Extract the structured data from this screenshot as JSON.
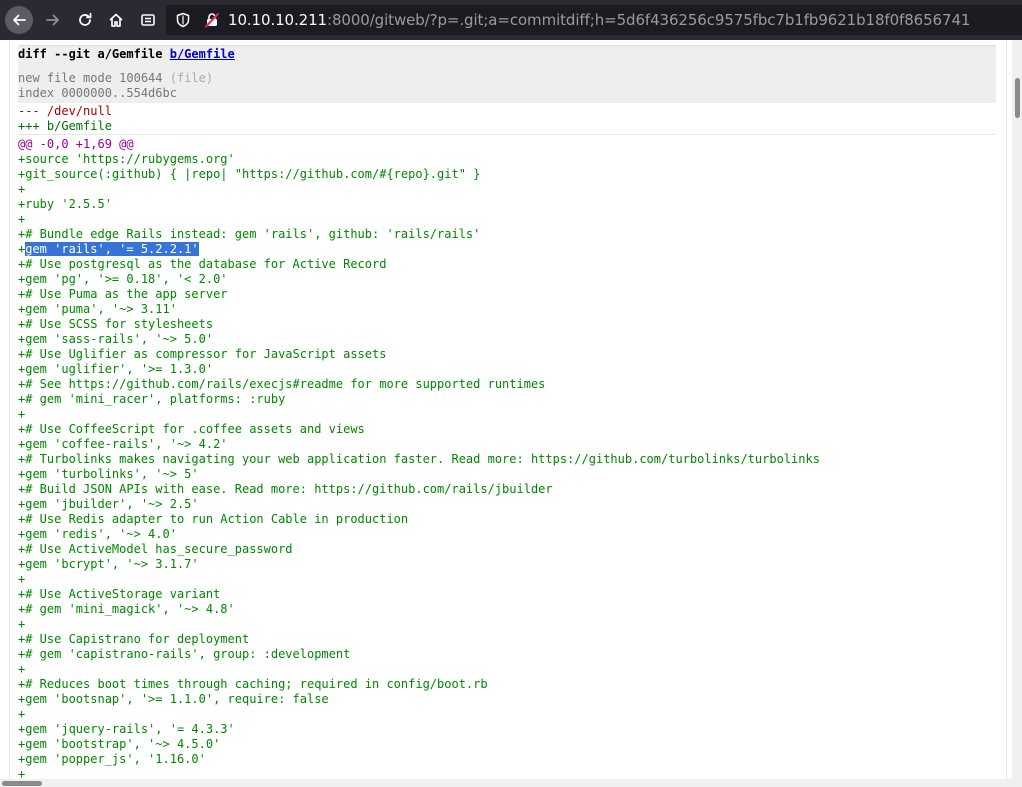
{
  "browser": {
    "url_host": "10.10.10.211",
    "url_rest": ":8000/gitweb/?p=.git;a=commitdiff;h=5d6f436256c9575fbc7b1fb9621b18f0f8656741"
  },
  "diff": {
    "git_prefix": "diff --git a/Gemfile ",
    "b_link": "b/Gemfile",
    "new_file_mode": "new file mode 100644",
    "new_file_note": "(file)",
    "index": "index 0000000..554d6bc",
    "from_file": "--- /dev/null",
    "to_file": "+++ b/Gemfile",
    "chunk_header": "@@ -0,0 +1,69 @@",
    "selected_text": "gem 'rails', '= 5.2.2.1'",
    "lines": [
      "+source 'https://rubygems.org'",
      "+git_source(:github) { |repo| \"https://github.com/#{repo}.git\" }",
      "+",
      "+ruby '2.5.5'",
      "+",
      "+# Bundle edge Rails instead: gem 'rails', github: 'rails/rails'",
      "+",
      "+# Use postgresql as the database for Active Record",
      "+gem 'pg', '>= 0.18', '< 2.0'",
      "+# Use Puma as the app server",
      "+gem 'puma', '~> 3.11'",
      "+# Use SCSS for stylesheets",
      "+gem 'sass-rails', '~> 5.0'",
      "+# Use Uglifier as compressor for JavaScript assets",
      "+gem 'uglifier', '>= 1.3.0'",
      "+# See https://github.com/rails/execjs#readme for more supported runtimes",
      "+# gem 'mini_racer', platforms: :ruby",
      "+",
      "+# Use CoffeeScript for .coffee assets and views",
      "+gem 'coffee-rails', '~> 4.2'",
      "+# Turbolinks makes navigating your web application faster. Read more: https://github.com/turbolinks/turbolinks",
      "+gem 'turbolinks', '~> 5'",
      "+# Build JSON APIs with ease. Read more: https://github.com/rails/jbuilder",
      "+gem 'jbuilder', '~> 2.5'",
      "+# Use Redis adapter to run Action Cable in production",
      "+gem 'redis', '~> 4.0'",
      "+# Use ActiveModel has_secure_password",
      "+gem 'bcrypt', '~> 3.1.7'",
      "+",
      "+# Use ActiveStorage variant",
      "+# gem 'mini_magick', '~> 4.8'",
      "+",
      "+# Use Capistrano for deployment",
      "+# gem 'capistrano-rails', group: :development",
      "+",
      "+# Reduces boot times through caching; required in config/boot.rb",
      "+gem 'bootsnap', '>= 1.1.0', require: false",
      "+",
      "+gem 'jquery-rails', '= 4.3.3'",
      "+gem 'bootstrap', '~> 4.5.0'",
      "+gem 'popper_js', '1.16.0'",
      "+"
    ]
  }
}
